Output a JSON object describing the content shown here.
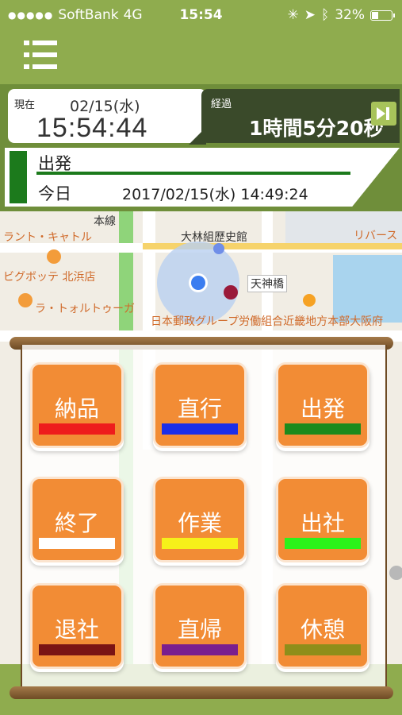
{
  "status_bar": {
    "carrier": "SoftBank",
    "network": "4G",
    "time": "15:54",
    "battery": "32%"
  },
  "header": {
    "now_label": "現在",
    "now_date": "02/15(水)",
    "now_time": "15:54:44",
    "elapsed_label": "経過",
    "elapsed_value": "1時間5分20秒"
  },
  "status": {
    "current": "出発",
    "day_label": "今日",
    "datetime": "2017/02/15(水) 14:49:24",
    "color": "#1c7a1c"
  },
  "map": {
    "labels": [
      "大林組歴史館",
      "リバース",
      "ラント・キャトル",
      "ビグボッテ 北浜店",
      "ラ・トォルトゥーガ",
      "天神橋",
      "日本郵政グループ労働組合近畿地方本部大阪府",
      "本線"
    ]
  },
  "actions": [
    {
      "label": "納品",
      "color": "#ee1c1c"
    },
    {
      "label": "直行",
      "color": "#1c2ee8"
    },
    {
      "label": "出発",
      "color": "#1c8a1c"
    },
    {
      "label": "終了",
      "color": "#ffffff"
    },
    {
      "label": "作業",
      "color": "#f6f01a"
    },
    {
      "label": "出社",
      "color": "#2cf21a"
    },
    {
      "label": "退社",
      "color": "#7a1414"
    },
    {
      "label": "直帰",
      "color": "#7a1e8e"
    },
    {
      "label": "休憩",
      "color": "#8e8e1a"
    }
  ]
}
